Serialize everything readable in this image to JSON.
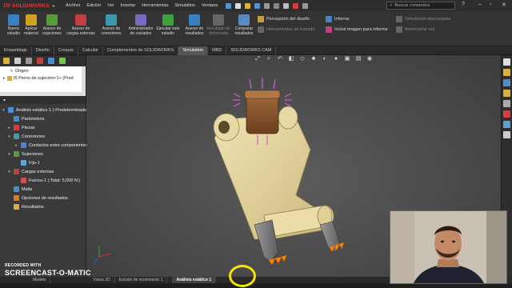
{
  "app": {
    "brand": "SOLIDWORKS",
    "brand_prefix": "DS"
  },
  "menu": [
    "Archivo",
    "Edición",
    "Ver",
    "Insertar",
    "Herramientas",
    "Simulation",
    "Ventana"
  ],
  "search": {
    "placeholder": "Buscar comandos"
  },
  "ribbon": {
    "buttons": [
      {
        "label": "Nuevo estudio",
        "color": "#3a7fc2"
      },
      {
        "label": "Aplicar material",
        "color": "#d0a020"
      },
      {
        "label": "Asesor de sujeciones",
        "color": "#5a9a3a"
      },
      {
        "label": "Asesor de cargas externas",
        "color": "#c04040"
      },
      {
        "label": "Asesor de conexiones",
        "color": "#3a9ab0"
      },
      {
        "label": "Administrador de vaciados",
        "color": "#7a6ac0"
      },
      {
        "label": "Ejecutar este estudio",
        "color": "#40a040"
      },
      {
        "label": "Asesor de resultados",
        "color": "#3a7fc2"
      },
      {
        "label": "Resultado de deformada",
        "color": "#777",
        "dim": true
      },
      {
        "label": "Comparar resultados",
        "color": "#5a8ac0"
      }
    ],
    "rows": [
      {
        "label": "Percepción del diseño",
        "dim": false
      },
      {
        "label": "Herramientas de trazado",
        "dim": true
      },
      {
        "label": "Informe",
        "dim": false
      },
      {
        "label": "Incluir imagen para informe",
        "dim": false
      },
      {
        "label": "Simulación descargada",
        "dim": true
      },
      {
        "label": "Administrar red",
        "dim": true
      }
    ]
  },
  "tabs": [
    "Ensamblaje",
    "Diseño",
    "Croquis",
    "Calcular",
    "Complementos de SOLIDWORKS",
    "Simulation",
    "MBD",
    "SOLIDWORKS CAM"
  ],
  "active_tab": "Simulation",
  "feature_tree": {
    "items": [
      "Origen",
      "(f) Perno de sujeción<1> (Pred"
    ]
  },
  "sim_tree": {
    "study": "Análisis estático 1 (-Predeterminado-)",
    "items": [
      {
        "label": "Parámetros",
        "indent": 1
      },
      {
        "label": "Piezas",
        "indent": 1
      },
      {
        "label": "Conexiones",
        "indent": 1
      },
      {
        "label": "Contactos entre componentes",
        "indent": 2
      },
      {
        "label": "Sujeciones",
        "indent": 1
      },
      {
        "label": "Fijo-1",
        "indent": 2
      },
      {
        "label": "Cargas externas",
        "indent": 1
      },
      {
        "label": "Fuerza-1 (:Total: 5,000 N:)",
        "indent": 2
      },
      {
        "label": "Malla",
        "indent": 1
      },
      {
        "label": "Opciones de resultados",
        "indent": 1
      },
      {
        "label": "Resultados",
        "indent": 1
      }
    ]
  },
  "bottom_tabs": [
    "Modelo",
    "Vistas 3D",
    "Estudio de movimiento 1",
    "Análisis estático 1"
  ],
  "active_bottom_tab": "Análisis estático 1",
  "watermark": {
    "line1": "RECORDED WITH",
    "line2": "SCREENCAST-O-MATIC"
  },
  "colors": {
    "accent_tab": "#555555",
    "model_body": "#e3d4a0",
    "model_bracket": "#8a5530",
    "fixture": "#d060d0",
    "load_arrow": "#ff8800"
  }
}
